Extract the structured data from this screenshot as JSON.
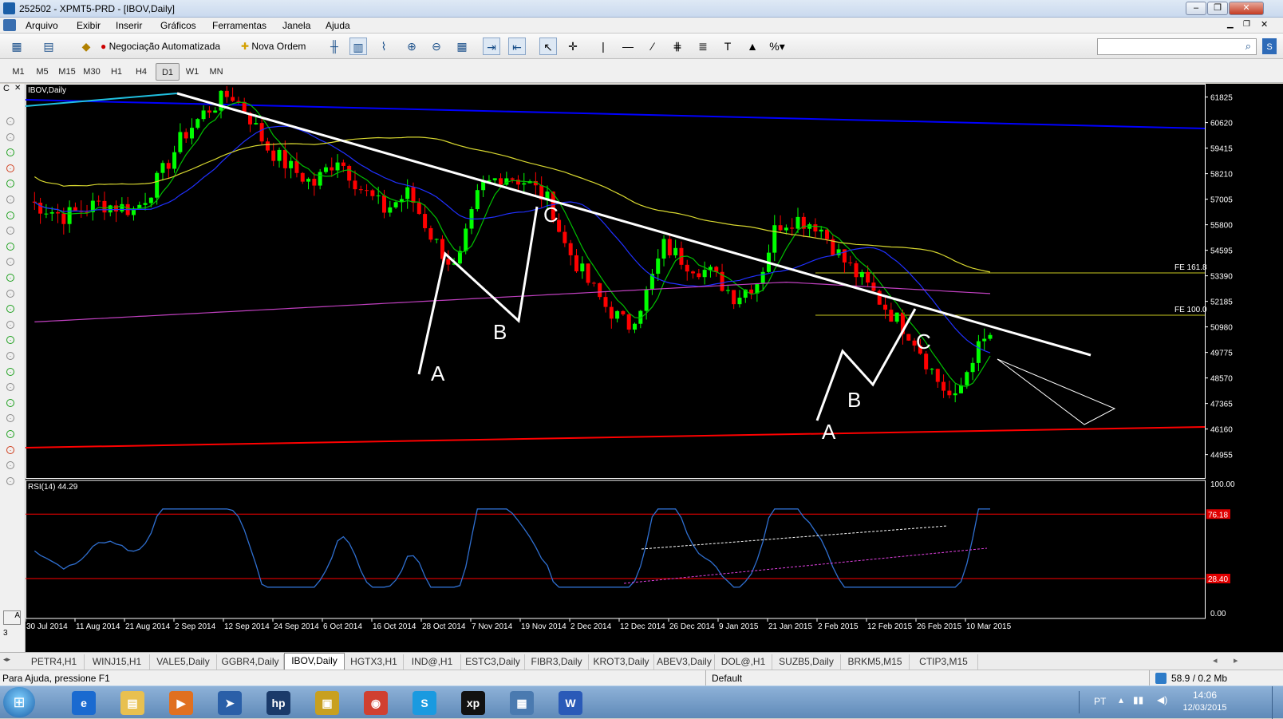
{
  "window": {
    "title": "252502 - XPMT5-PRD - [IBOV,Daily]"
  },
  "menu": [
    "Arquivo",
    "Exibir",
    "Inserir",
    "Gráficos",
    "Ferramentas",
    "Janela",
    "Ajuda"
  ],
  "toolbar": {
    "auto_trading": "Negociação Automatizada",
    "new_order": "Nova Ordem"
  },
  "timeframes": [
    "M1",
    "M5",
    "M15",
    "M30",
    "H1",
    "H4",
    "D1",
    "W1",
    "MN"
  ],
  "selected_timeframe": "D1",
  "chart": {
    "label": "IBOV,Daily",
    "yticks": [
      "61825",
      "60620",
      "59415",
      "58210",
      "57005",
      "55800",
      "54595",
      "53390",
      "52185",
      "50980",
      "49775",
      "48570",
      "47365",
      "46160",
      "44955"
    ],
    "xticks": [
      "30 Jul 2014",
      "11 Aug 2014",
      "21 Aug 2014",
      "2 Sep 2014",
      "12 Sep 2014",
      "24 Sep 2014",
      "6 Oct 2014",
      "16 Oct 2014",
      "28 Oct 2014",
      "7 Nov 2014",
      "19 Nov 2014",
      "2 Dec 2014",
      "12 Dec 2014",
      "26 Dec 2014",
      "9 Jan 2015",
      "21 Jan 2015",
      "2 Feb 2015",
      "12 Feb 2015",
      "26 Feb 2015",
      "10 Mar 2015"
    ],
    "fe161": "FE 161.8",
    "fe100": "FE 100.0",
    "wave_labels": [
      "A",
      "B",
      "C",
      "A",
      "B",
      "C"
    ]
  },
  "rsi": {
    "label": "RSI(14) 44.29",
    "yticks": [
      "100.00",
      "0.00"
    ],
    "levels": [
      "76.18",
      "28.40"
    ],
    "colors": {
      "line": "#2f6fd0",
      "level": "#ff0000"
    }
  },
  "left_panel": {
    "top_label": "C",
    "bottom_label": "A",
    "page_label": "3"
  },
  "tabs": [
    "PETR4,H1",
    "WINJ15,H1",
    "VALE5,Daily",
    "GGBR4,Daily",
    "IBOV,Daily",
    "HGTX3,H1",
    "IND@,H1",
    "ESTC3,Daily",
    "FIBR3,Daily",
    "KROT3,Daily",
    "ABEV3,Daily",
    "DOL@,H1",
    "SUZB5,Daily",
    "BRKM5,M15",
    "CTIP3,M15"
  ],
  "active_tab": "IBOV,Daily",
  "status": {
    "help": "Para Ajuda, pressione F1",
    "profile": "Default",
    "traffic": "58.9 / 0.2 Mb"
  },
  "taskbar": {
    "lang": "PT",
    "time": "14:06",
    "date": "12/03/2015",
    "apps": [
      "ie-icon",
      "explorer-icon",
      "media-icon",
      "remote-icon",
      "hp-icon",
      "tool-icon",
      "chrome-icon",
      "skype-icon",
      "xp-icon",
      "metatrader-icon",
      "word-icon"
    ]
  },
  "colors": {
    "up": "#00ff00",
    "down": "#ff0000",
    "ma_fast": "#00c000",
    "ma_mid": "#2030ff",
    "ma_slow": "#d8d830",
    "ma_long": "#c040c0",
    "trend": "#ffffff",
    "channel_top": "#0000ff",
    "channel_bottom": "#ff0000"
  }
}
